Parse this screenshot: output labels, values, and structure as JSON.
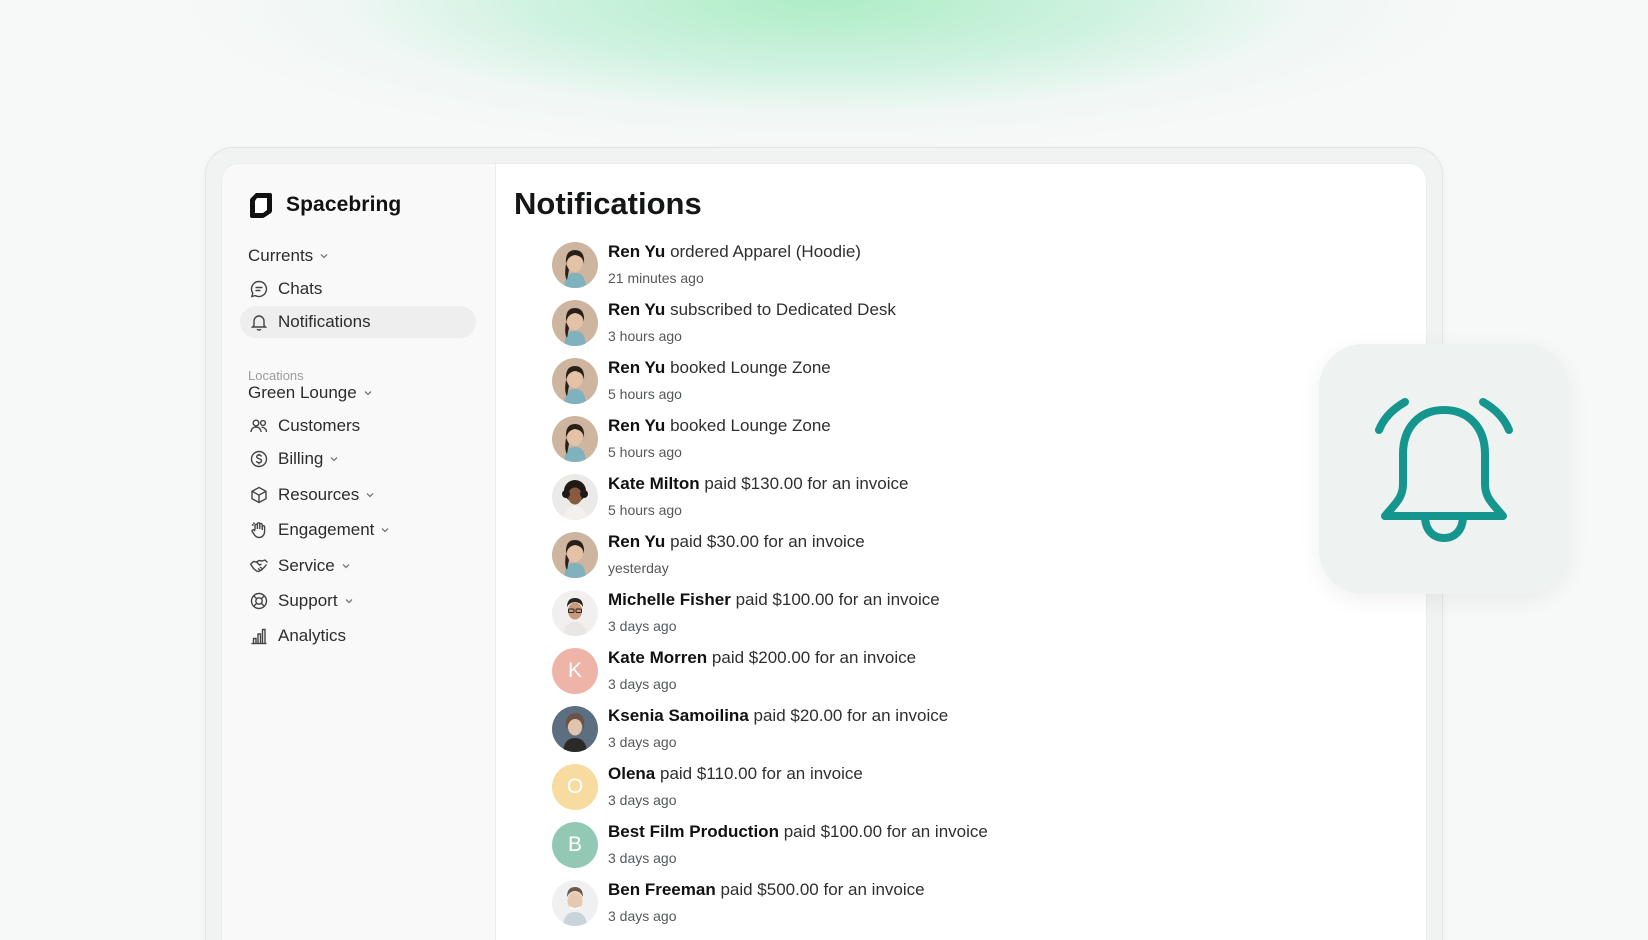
{
  "brand": {
    "name": "Spacebring"
  },
  "sidebar": {
    "currents_label": "Currents",
    "items_top": [
      {
        "label": "Chats",
        "icon": "chat-icon"
      },
      {
        "label": "Notifications",
        "icon": "bell-icon",
        "active": true
      }
    ],
    "locations_label": "Locations",
    "location_selected": "Green Lounge",
    "items_location": [
      {
        "label": "Customers",
        "icon": "users-icon"
      },
      {
        "label": "Billing",
        "icon": "dollar-icon"
      },
      {
        "label": "Resources",
        "icon": "box-icon"
      },
      {
        "label": "Engagement",
        "icon": "hand-icon"
      },
      {
        "label": "Service",
        "icon": "handshake-icon"
      },
      {
        "label": "Support",
        "icon": "lifebuoy-icon"
      },
      {
        "label": "Analytics",
        "icon": "chart-icon"
      }
    ]
  },
  "main": {
    "title": "Notifications"
  },
  "notifications": [
    {
      "name": "Ren Yu",
      "action": "ordered Apparel (Hoodie)",
      "time": "21 minutes ago",
      "avatar": "photo-ren"
    },
    {
      "name": "Ren Yu",
      "action": "subscribed to Dedicated Desk",
      "time": "3 hours ago",
      "avatar": "photo-ren"
    },
    {
      "name": "Ren Yu",
      "action": "booked Lounge Zone",
      "time": "5 hours ago",
      "avatar": "photo-ren"
    },
    {
      "name": "Ren Yu",
      "action": "booked Lounge Zone",
      "time": "5 hours ago",
      "avatar": "photo-ren"
    },
    {
      "name": "Kate Milton",
      "action": "paid $130.00 for an invoice",
      "time": "5 hours ago",
      "avatar": "photo-kate-milton"
    },
    {
      "name": "Ren Yu",
      "action": "paid $30.00 for an invoice",
      "time": "yesterday",
      "avatar": "photo-ren"
    },
    {
      "name": "Michelle Fisher",
      "action": "paid $100.00 for an invoice",
      "time": "3 days ago",
      "avatar": "photo-michelle"
    },
    {
      "name": "Kate Morren",
      "action": "paid $200.00 for an invoice",
      "time": "3 days ago",
      "avatar": "letter",
      "letter": "K",
      "color": "#efb4a8"
    },
    {
      "name": "Ksenia Samoilina",
      "action": "paid $20.00 for an invoice",
      "time": "3 days ago",
      "avatar": "photo-ksenia"
    },
    {
      "name": "Olena",
      "action": "paid $110.00 for an invoice",
      "time": "3 days ago",
      "avatar": "letter",
      "letter": "O",
      "color": "#f8dba0"
    },
    {
      "name": "Best Film Production",
      "action": "paid $100.00 for an invoice",
      "time": "3 days ago",
      "avatar": "letter",
      "letter": "B",
      "color": "#93c9b4"
    },
    {
      "name": "Ben Freeman",
      "action": "paid $500.00 for an invoice",
      "time": "3 days ago",
      "avatar": "photo-ben"
    }
  ],
  "colors": {
    "accent_teal": "#14968e",
    "active_bg": "#eeeeee"
  }
}
